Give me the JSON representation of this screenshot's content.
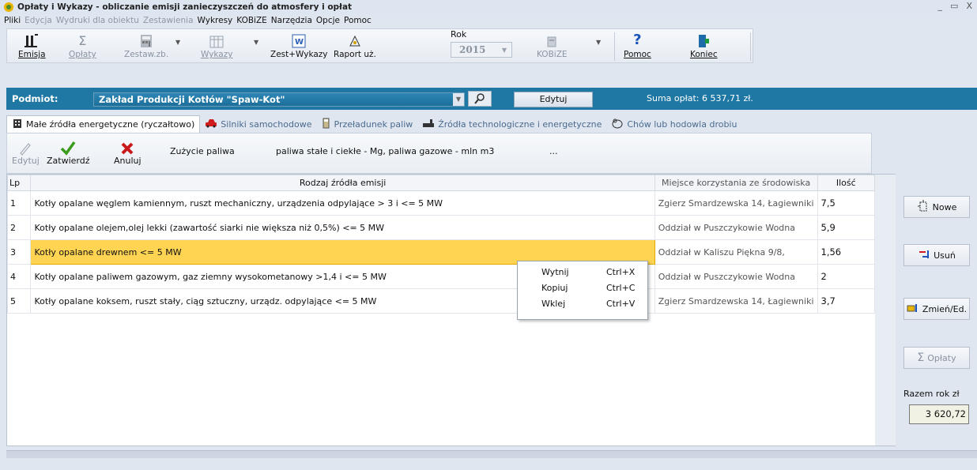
{
  "window": {
    "title": "Opłaty i Wykazy  - obliczanie emisji zanieczyszczeń do atmosfery i opłat",
    "minimize": "_",
    "maximize": "▭",
    "close": "X"
  },
  "menu": [
    {
      "label": "Pliki",
      "disabled": false
    },
    {
      "label": "Edycja",
      "disabled": true
    },
    {
      "label": "Wydruki dla obiektu",
      "disabled": true
    },
    {
      "label": "Zestawienia",
      "disabled": true
    },
    {
      "label": "Wykresy",
      "disabled": false
    },
    {
      "label": "KOBiZE",
      "disabled": false
    },
    {
      "label": "Narzędzia",
      "disabled": false
    },
    {
      "label": "Opcje",
      "disabled": false
    },
    {
      "label": "Pomoc",
      "disabled": false
    }
  ],
  "toolbar": {
    "emisja": "Emisja",
    "oplaty": "Opłaty",
    "zestaw": "Zestaw.zb.",
    "wykazy": "Wykazy",
    "zest_wykazy": "Zest+Wykazy",
    "raport": "Raport uż.",
    "rok_label": "Rok",
    "rok_value": "2015",
    "kobize": "KOBiZE",
    "pomoc": "Pomoc",
    "koniec": "Koniec"
  },
  "subject": {
    "label": "Podmiot:",
    "value": "Zakład Produkcji Kotłów \"Spaw-Kot\"",
    "edit_button": "Edytuj",
    "sum": "Suma opłat:  6 537,71 zł."
  },
  "tabs": [
    {
      "label": "Małe źródła energetyczne (ryczałtowo)",
      "icon": "building-icon"
    },
    {
      "label": "Silniki samochodowe",
      "icon": "car-icon"
    },
    {
      "label": "Przeładunek paliw",
      "icon": "fuel-pump-icon"
    },
    {
      "label": "Źródła technologiczne i energetyczne",
      "icon": "factory-icon"
    },
    {
      "label": "Chów lub hodowla drobiu",
      "icon": "poultry-icon"
    }
  ],
  "subtoolbar": {
    "edit": "Edytuj",
    "confirm": "Zatwierdź",
    "cancel": "Anuluj",
    "fuel_usage": "Zużycie paliwa",
    "fuel_units": "paliwa stałe i ciekłe - Mg,  paliwa gazowe - mln m3",
    "more": "..."
  },
  "table": {
    "headers": {
      "lp": "Lp",
      "name": "Rodzaj źródła emisji",
      "place": "Miejsce korzystania ze środowiska",
      "qty": "Ilość"
    },
    "rows": [
      {
        "lp": "1",
        "name": "Kotły opalane węglem kamiennym, ruszt mechaniczny, urządzenia odpylające > 3 i <= 5 MW",
        "place": "Zgierz Smardzewska 14, Łagiewniki",
        "qty": "7,5"
      },
      {
        "lp": "2",
        "name": "Kotły opalane olejem,olej lekki (zawartość siarki nie większa niż 0,5%) <= 5 MW",
        "place": "Oddział w Puszczykowie Wodna",
        "qty": "5,9"
      },
      {
        "lp": "3",
        "name": "Kotły opalane drewnem <= 5 MW",
        "place": "Oddział w Kaliszu Piękna 9/8,",
        "qty": "1,56"
      },
      {
        "lp": "4",
        "name": "Kotły opalane paliwem gazowym, gaz ziemny wysokometanowy >1,4 i <= 5 MW",
        "place": "Oddział w Puszczykowie Wodna",
        "qty": "2"
      },
      {
        "lp": "5",
        "name": "Kotły opalane koksem, ruszt stały, ciąg sztuczny, urządz. odpylające <= 5 MW",
        "place": "Zgierz Smardzewska 14, Łagiewniki",
        "qty": "3,7"
      }
    ]
  },
  "context_menu": [
    {
      "label": "Wytnij",
      "shortcut": "Ctrl+X"
    },
    {
      "label": "Kopiuj",
      "shortcut": "Ctrl+C"
    },
    {
      "label": "Wklej",
      "shortcut": "Ctrl+V"
    }
  ],
  "side": {
    "new": "Nowe",
    "delete": "Usuń",
    "change": "Zmień/Ed.",
    "fees": "Opłaty",
    "total_label": "Razem rok zł",
    "total_value": "3 620,72"
  }
}
